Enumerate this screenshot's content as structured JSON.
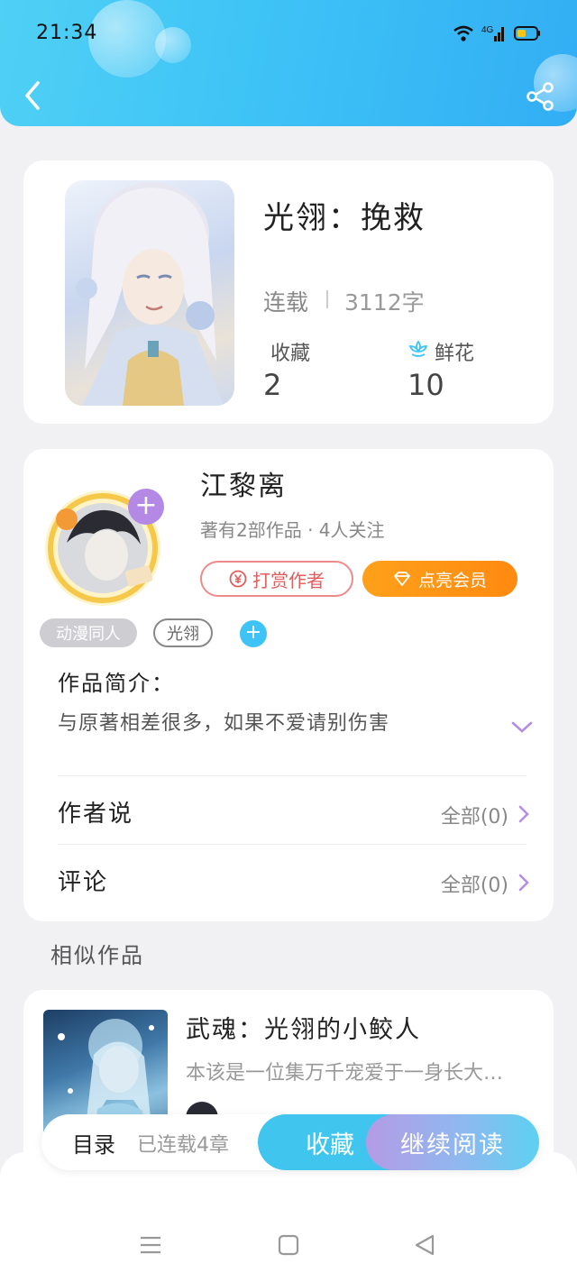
{
  "status_bar": {
    "time": "21:34",
    "network": "4G",
    "icons": [
      "wifi-icon",
      "signal-icon",
      "battery-icon"
    ]
  },
  "header": {
    "back_icon": "chevron-left-icon",
    "share_icon": "share-icon"
  },
  "book": {
    "title": "光翎：挽救",
    "status": "连载",
    "word_count": "3112字",
    "favorites_label": "收藏",
    "favorites_value": "2",
    "flowers_label": "鲜花",
    "flowers_value": "10"
  },
  "author": {
    "name": "江黎离",
    "meta": "著有2部作品 · 4人关注",
    "tip_label": "打赏作者",
    "vip_label": "点亮会员"
  },
  "tags": [
    "动漫同人",
    "光翎"
  ],
  "intro": {
    "title": "作品简介：",
    "text": "与原著相差很多，如果不爱请别伤害"
  },
  "rows": {
    "author_says_label": "作者说",
    "author_says_value": "全部(0)",
    "comments_label": "评论",
    "comments_value": "全部(0)"
  },
  "similar": {
    "section_title": "相似作品",
    "items": [
      {
        "title": "武魂：光翎的小鲛人",
        "desc": "本该是一位集万千宠爱于一身长大…"
      }
    ]
  },
  "action_bar": {
    "toc_label": "目录",
    "chapters_label": "已连载4章",
    "favorite_label": "收藏",
    "read_label": "继续阅读"
  },
  "colors": {
    "accent_blue": "#3ec3f6",
    "tip_red": "#e45c5c",
    "vip_orange": "#ff9512",
    "purple": "#b48ee6"
  }
}
